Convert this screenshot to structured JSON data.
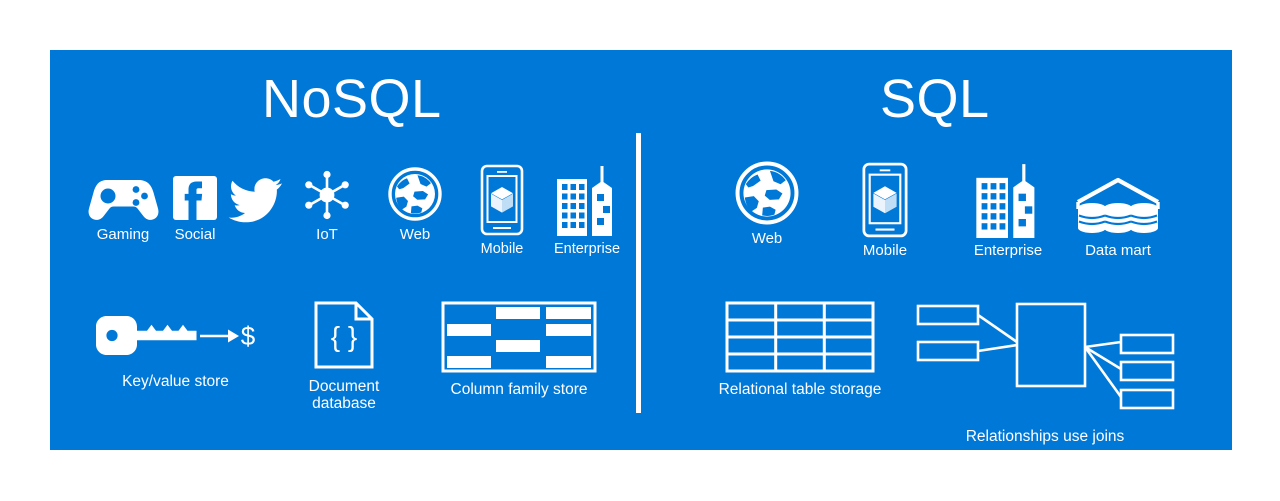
{
  "background_color": "#ffffff",
  "panel_color": "#0078d7",
  "foreground_color": "#ffffff",
  "sections": {
    "nosql": {
      "title": "NoSQL",
      "workloads": [
        {
          "label": "Gaming",
          "icon": "game-controller-icon"
        },
        {
          "label": "Social",
          "icon": "facebook-icon"
        },
        {
          "label": "",
          "icon": "twitter-bird-icon"
        },
        {
          "label": "IoT",
          "icon": "iot-hub-spoke-icon"
        },
        {
          "label": "Web",
          "icon": "globe-icon"
        },
        {
          "label": "Mobile",
          "icon": "mobile-phone-cube-icon"
        },
        {
          "label": "Enterprise",
          "icon": "buildings-icon"
        }
      ],
      "stores": [
        {
          "label": "Key/value store",
          "icon": "key-arrow-dollar-icon"
        },
        {
          "label": "Document\ndatabase",
          "icon": "document-braces-icon"
        },
        {
          "label": "Column family store",
          "icon": "column-family-grid-icon"
        }
      ]
    },
    "sql": {
      "title": "SQL",
      "workloads": [
        {
          "label": "Web",
          "icon": "globe-icon"
        },
        {
          "label": "Mobile",
          "icon": "mobile-phone-cube-icon"
        },
        {
          "label": "Enterprise",
          "icon": "buildings-icon"
        },
        {
          "label": "Data mart",
          "icon": "data-mart-icon"
        }
      ],
      "stores": [
        {
          "label": "Relational table storage",
          "icon": "relational-table-icon"
        },
        {
          "label": "Relationships use joins",
          "icon": "join-relationship-icon"
        }
      ]
    }
  },
  "key_value": {
    "dollar_symbol": "$"
  },
  "document": {
    "braces": "{ }"
  },
  "column_family_store": {
    "rows": 4,
    "columns": 3,
    "filled_cells": [
      [
        0,
        1,
        1
      ],
      [
        1,
        0,
        1
      ],
      [
        0,
        1,
        0
      ],
      [
        1,
        0,
        1
      ]
    ]
  },
  "relational_table": {
    "rows": 4,
    "columns": 3
  },
  "join_diagram": {
    "left_boxes": 2,
    "center_boxes": 1,
    "right_boxes": 3
  }
}
